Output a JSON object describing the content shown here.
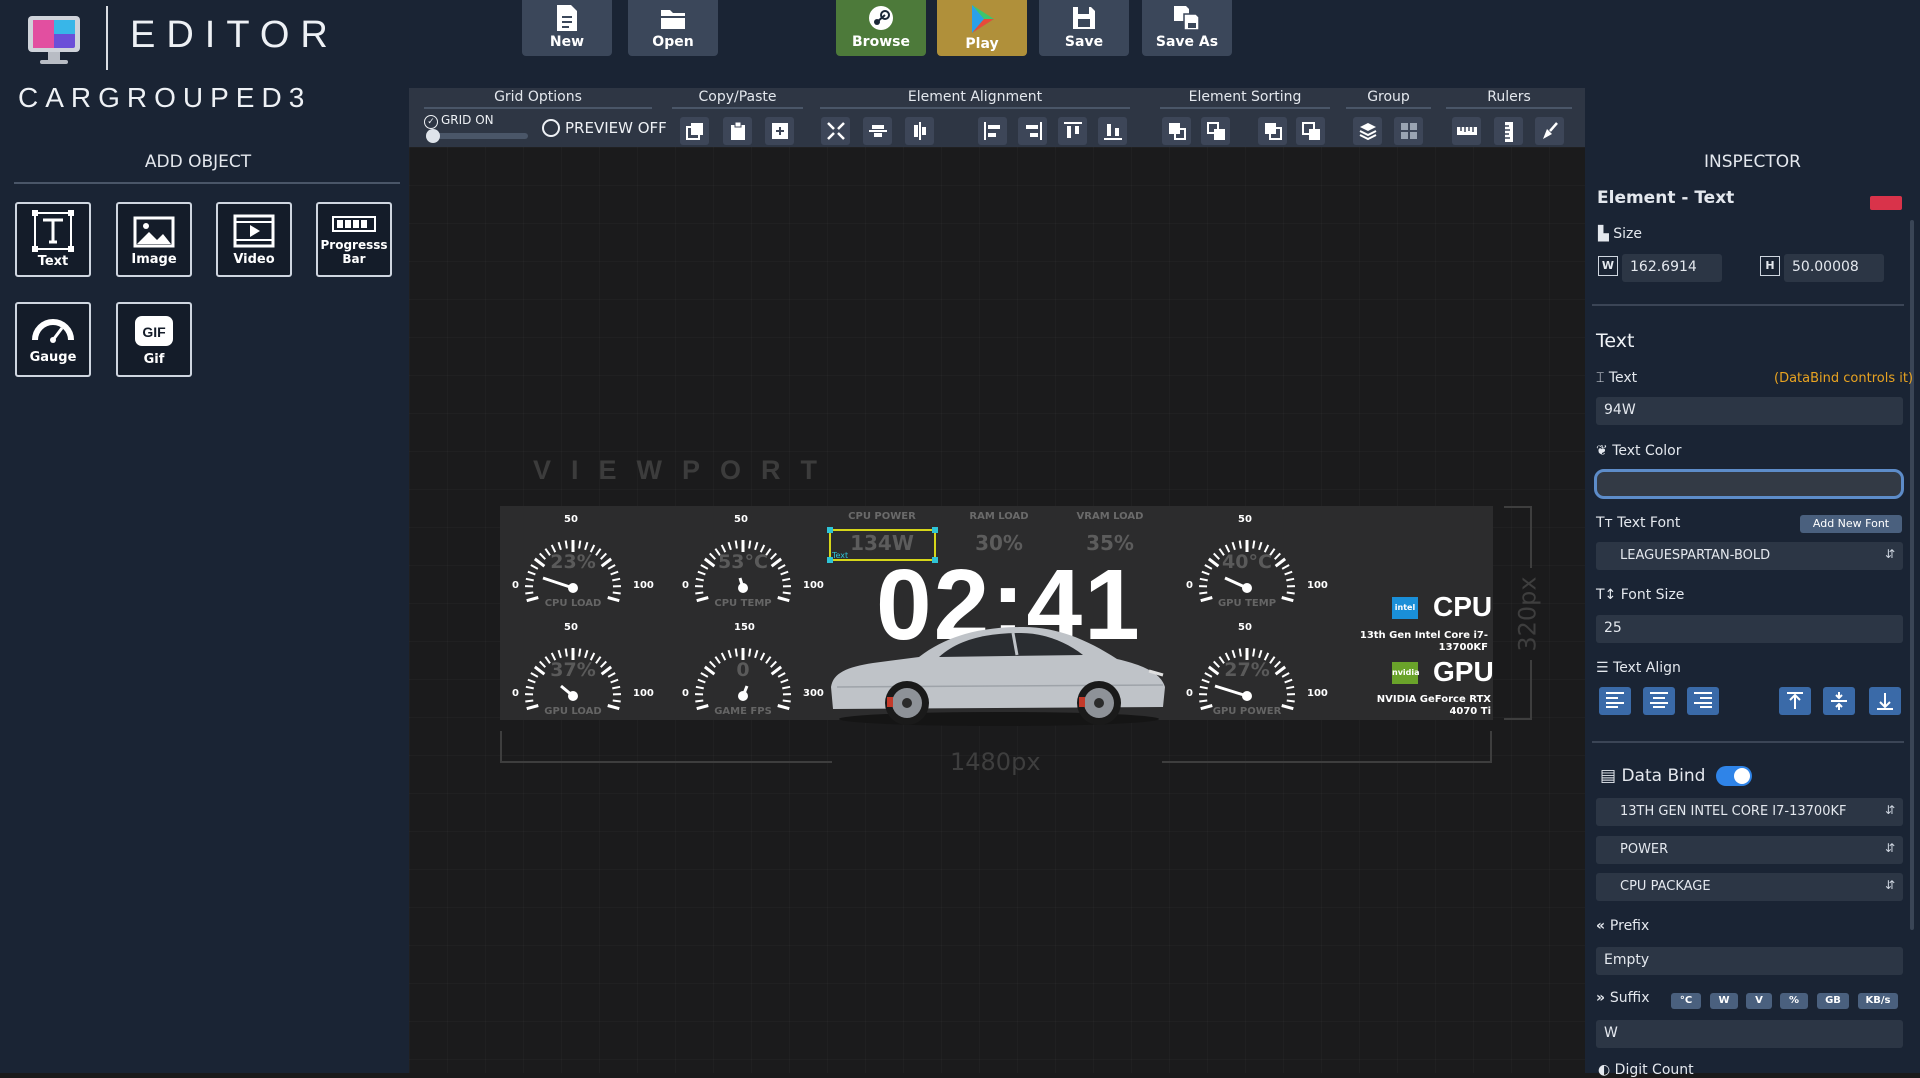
{
  "app": {
    "title": "EDITOR",
    "project_name": "CARGROUPED3"
  },
  "left_panel": {
    "heading": "ADD OBJECT",
    "objects": [
      {
        "label": "Text",
        "icon": "text-icon"
      },
      {
        "label": "Image",
        "icon": "image-icon"
      },
      {
        "label": "Video",
        "icon": "video-icon"
      },
      {
        "label": "Progresss Bar",
        "icon": "progress-bar-icon"
      },
      {
        "label": "Gauge",
        "icon": "gauge-icon"
      },
      {
        "label": "Gif",
        "icon": "gif-icon"
      }
    ]
  },
  "toolbar": {
    "buttons": [
      {
        "label": "New",
        "icon": "file-icon"
      },
      {
        "label": "Open",
        "icon": "folder-icon"
      },
      {
        "label": "Browse",
        "icon": "steam-icon",
        "color": "#4d7a3a"
      },
      {
        "label": "Play",
        "icon": "play-icon",
        "color": "#b0903a"
      },
      {
        "label": "Save",
        "icon": "save-icon"
      },
      {
        "label": "Save As",
        "icon": "save-as-icon"
      }
    ]
  },
  "options_bar": {
    "groups": [
      "Grid Options",
      "Copy/Paste",
      "Element Alignment",
      "Element Sorting",
      "Group",
      "Rulers"
    ],
    "grid_on_label": "GRID ON",
    "preview_label": "PREVIEW OFF",
    "grid_slider_value": 0.05
  },
  "canvas": {
    "viewport_label": "VIEWPORT",
    "width_label": "1480px",
    "height_label": "320px",
    "dashboard": {
      "gauges": [
        {
          "value": "23%",
          "label": "CPU LOAD",
          "min": "0",
          "mid": "50",
          "max": "100"
        },
        {
          "value": "53°C",
          "label": "CPU TEMP",
          "min": "0",
          "mid": "50",
          "max": "100"
        },
        {
          "value": "37%",
          "label": "GPU LOAD",
          "min": "0",
          "mid": "50",
          "max": "100"
        },
        {
          "value": "0",
          "label": "GAME FPS",
          "min": "0",
          "mid": "150",
          "max": "300"
        },
        {
          "value": "40°C",
          "label": "GPU TEMP",
          "min": "0",
          "mid": "50",
          "max": "100"
        },
        {
          "value": "27%",
          "label": "GPU POWER",
          "min": "0",
          "mid": "50",
          "max": "100"
        }
      ],
      "top_stats": [
        {
          "label": "CPU POWER",
          "value": "134W"
        },
        {
          "label": "RAM LOAD",
          "value": "30%"
        },
        {
          "label": "VRAM LOAD",
          "value": "35%"
        }
      ],
      "selection_tag": "Text",
      "clock": "02:41",
      "cpu": {
        "title": "CPU",
        "name": "13th Gen Intel Core i7-13700KF",
        "logo": "intel",
        "logo_color": "#1a8fd8"
      },
      "gpu": {
        "title": "GPU",
        "name": "NVIDIA GeForce RTX 4070 Ti",
        "logo": "nvidia",
        "logo_color": "#6aa32a"
      }
    }
  },
  "inspector": {
    "title": "INSPECTOR",
    "element_header": "Element - Text",
    "size_label": "Size",
    "w_label": "W",
    "h_label": "H",
    "width_value": "162.6914",
    "height_value": "50.00008",
    "text_section": "Text",
    "text_label": "Text",
    "databind_note": "(DataBind controls it)",
    "text_value": "94W",
    "text_color_label": "Text Color",
    "text_font_label": "Text Font",
    "add_font_label": "Add New Font",
    "font_value": "LEAGUESPARTAN-BOLD",
    "font_size_label": "Font Size",
    "font_size_value": "25",
    "text_align_label": "Text Align",
    "data_bind_label": "Data Bind",
    "data_bind_enabled": true,
    "data_bind_hardware": "13TH GEN INTEL CORE I7-13700KF",
    "data_bind_type": "POWER",
    "data_bind_sensor": "CPU PACKAGE",
    "prefix_label": "Prefix",
    "prefix_value": "Empty",
    "suffix_label": "Suffix",
    "suffix_chips": [
      "°C",
      "W",
      "V",
      "%",
      "GB",
      "KB/s"
    ],
    "suffix_value": "W",
    "digit_count_label": "Digit Count"
  }
}
